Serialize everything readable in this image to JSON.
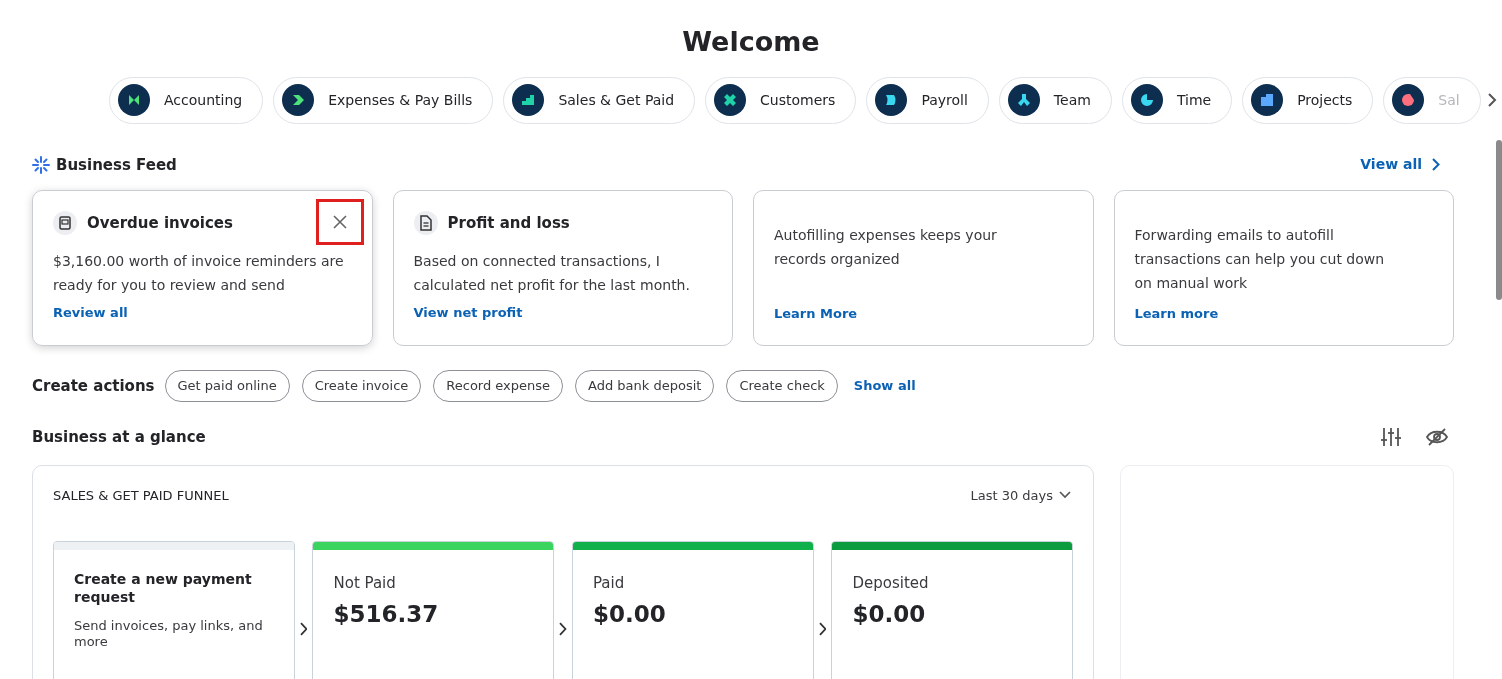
{
  "title": "Welcome",
  "nav_pills": [
    {
      "label": "Accounting",
      "color": "#4ee37a"
    },
    {
      "label": "Expenses & Pay Bills",
      "color": "#4ee37a"
    },
    {
      "label": "Sales & Get Paid",
      "color": "#1fd2a8"
    },
    {
      "label": "Customers",
      "color": "#1fd2a8"
    },
    {
      "label": "Payroll",
      "color": "#3ad8f0"
    },
    {
      "label": "Team",
      "color": "#3ad8f0"
    },
    {
      "label": "Time",
      "color": "#3ad8f0"
    },
    {
      "label": "Projects",
      "color": "#5aa9ff"
    },
    {
      "label": "Sal",
      "color": "#ff6f7d"
    }
  ],
  "business_feed": {
    "title": "Business Feed",
    "view_all": "View all",
    "cards": [
      {
        "kind": "titled",
        "title": "Overdue invoices",
        "body": "$3,160.00 worth of invoice reminders are ready for you to review and send",
        "link": "Review all",
        "dismissable": true,
        "highlighted": true
      },
      {
        "kind": "titled",
        "title": "Profit and loss",
        "body": "Based on connected transactions, I calculated net profit for the last month.",
        "link": "View net profit",
        "dismissable": false,
        "highlighted": false
      },
      {
        "kind": "plain",
        "body": "Autofilling expenses keeps your records organized",
        "link": "Learn More",
        "dismissable": false,
        "highlighted": false
      },
      {
        "kind": "plain",
        "body": "Forwarding emails to autofill transactions can help you cut down on manual work",
        "link": "Learn more",
        "dismissable": false,
        "highlighted": false
      }
    ]
  },
  "create_actions": {
    "label": "Create actions",
    "buttons": [
      "Get paid online",
      "Create invoice",
      "Record expense",
      "Add bank deposit",
      "Create check"
    ],
    "show_all": "Show all"
  },
  "business_at_a_glance": {
    "title": "Business at a glance",
    "funnel": {
      "title": "SALES & GET PAID FUNNEL",
      "period": "Last 30 days",
      "stages": [
        {
          "kind": "action",
          "title": "Create a new payment request",
          "description": "Send invoices, pay links, and more",
          "color": "#eef1f4"
        },
        {
          "kind": "stage",
          "label": "Not Paid",
          "amount": "$516.37",
          "color": "#3bd45f"
        },
        {
          "kind": "stage",
          "label": "Paid",
          "amount": "$0.00",
          "color": "#10b14b"
        },
        {
          "kind": "stage",
          "label": "Deposited",
          "amount": "$0.00",
          "color": "#0c9b3e"
        }
      ]
    }
  }
}
